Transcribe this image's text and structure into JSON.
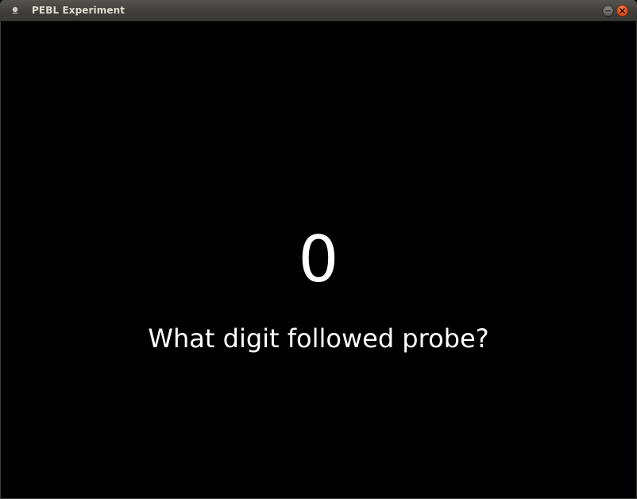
{
  "window": {
    "title": "PEBL Experiment"
  },
  "display": {
    "digit": "0",
    "prompt": "What digit followed probe?"
  },
  "colors": {
    "background": "#000000",
    "text": "#ffffff",
    "titlebar": "#3c3b37",
    "close_button": "#dd4814"
  }
}
